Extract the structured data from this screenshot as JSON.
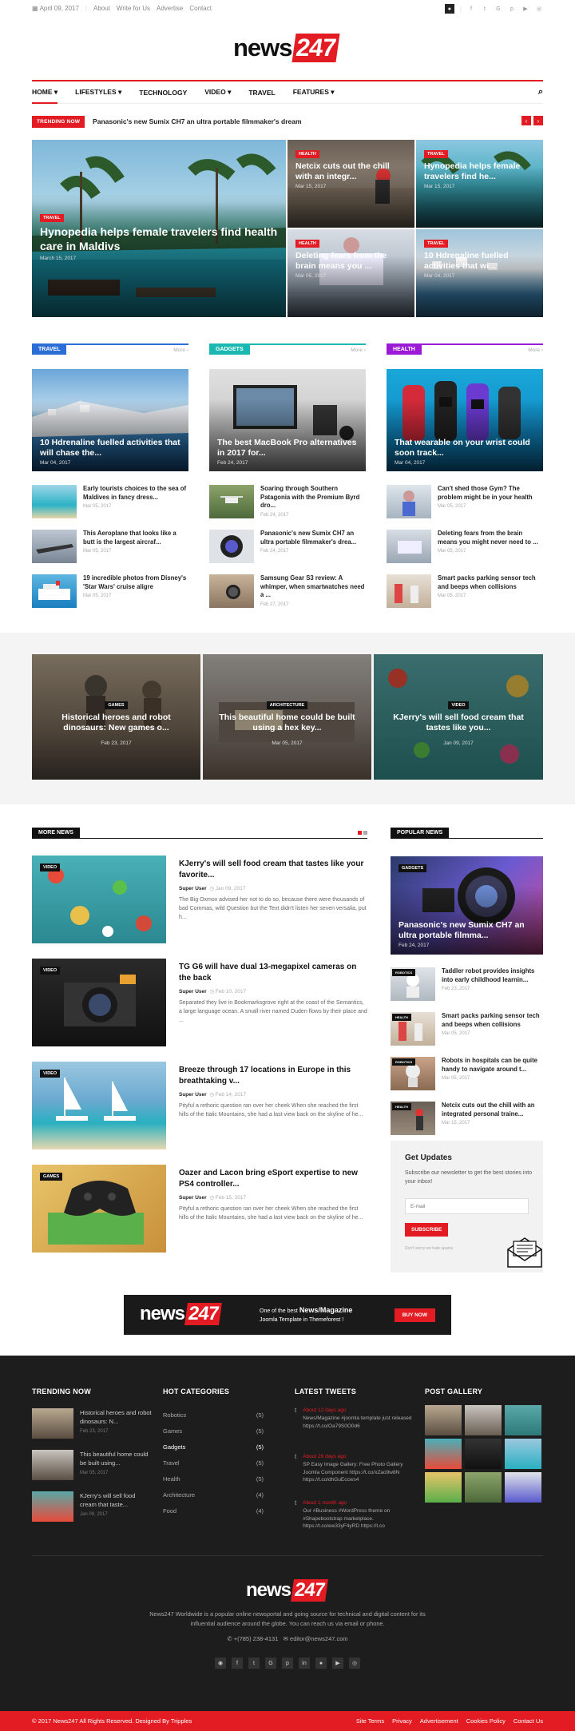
{
  "topbar": {
    "date": "April 09, 2017",
    "links": [
      "About",
      "Write for Us",
      "Advertise",
      "Contact"
    ]
  },
  "brand": {
    "name": "news",
    "number": "247",
    "accent": "#e31b23"
  },
  "nav": {
    "items": [
      "HOME",
      "LIFESTYLES",
      "TECHNOLOGY",
      "VIDEO",
      "TRAVEL",
      "FEATURES"
    ]
  },
  "trending": {
    "label": "TRENDING NOW",
    "text": "Panasonic's new Sumix CH7 an ultra portable filmmaker's dream"
  },
  "hero": {
    "main": {
      "tag": "TRAVEL",
      "title": "Hynopedia helps female travelers find health care in Maldivs",
      "date": "March 15, 2017"
    },
    "grid": [
      {
        "tag": "HEALTH",
        "title": "Netcix cuts out the chill with an integr...",
        "date": "Mar 15, 2017"
      },
      {
        "tag": "TRAVEL",
        "title": "Hynopedia helps female travelers find he...",
        "date": "Mar 15, 2017"
      },
      {
        "tag": "HEALTH",
        "title": "Deleting fears from the brain means you ...",
        "date": "Mar 05, 2017"
      },
      {
        "tag": "TRAVEL",
        "title": "10 Hdrenaline fuelled activities that wi...",
        "date": "Mar 04, 2017"
      }
    ]
  },
  "sections": [
    {
      "label": "TRAVEL",
      "more": "More",
      "color": "#2b6fd6",
      "lead": {
        "title": "10 Hdrenaline fuelled activities that will chase the...",
        "date": "Mar 04, 2017"
      },
      "items": [
        {
          "title": "Early tourists choices to the sea of Maldives in fancy dress...",
          "date": "Mar 05, 2017"
        },
        {
          "title": "This Aeroplane that looks like a butt is the largest aircraf...",
          "date": "Mar 05, 2017"
        },
        {
          "title": "19 incredible photos from Disney's 'Star Wars' cruise aligre",
          "date": "Mar 05, 2017"
        }
      ]
    },
    {
      "label": "GADGETS",
      "more": "More",
      "color": "#1ab8b0",
      "lead": {
        "title": "The best MacBook Pro alternatives in 2017 for...",
        "date": "Feb 24, 2017"
      },
      "items": [
        {
          "title": "Soaring through Southern Patagonia with the Premium Byrd dro...",
          "date": "Feb 24, 2017"
        },
        {
          "title": "Panasonic's new Sumix CH7 an ultra portable filmmaker's drea...",
          "date": "Feb 24, 2017"
        },
        {
          "title": "Samsung Gear S3 review: A whimper, when smartwatches need a ...",
          "date": "Feb 27, 2017"
        }
      ]
    },
    {
      "label": "HEALTH",
      "more": "More",
      "color": "#9b1ad6",
      "lead": {
        "title": "That wearable on your wrist could soon track...",
        "date": "Mar 04, 2017"
      },
      "items": [
        {
          "title": "Can't shed those Gym? The problem might be in your health",
          "date": "Mar 05, 2017"
        },
        {
          "title": "Deleting fears from the brain means you might never need to ...",
          "date": "Mar 05, 2017"
        },
        {
          "title": "Smart packs parking sensor tech and beeps when collisions",
          "date": "Mar 05, 2017"
        }
      ]
    }
  ],
  "featured": [
    {
      "tag": "GAMES",
      "title": "Historical heroes and robot dinosaurs: New games o...",
      "date": "Feb 23, 2017"
    },
    {
      "tag": "ARCHITECTURE",
      "title": "This beautiful home could be built using a hex key...",
      "date": "Mar 05, 2017"
    },
    {
      "tag": "VIDEO",
      "title": "KJerry's will sell food cream that tastes like you...",
      "date": "Jan 09, 2017"
    }
  ],
  "more_news": {
    "label": "MORE NEWS",
    "items": [
      {
        "tag": "VIDEO",
        "title": "KJerry's will sell food cream that tastes like your favorite...",
        "author": "Super User",
        "date": "Jan 09, 2017",
        "excerpt": "The Big Oxmox advised her not to do so, because there were thousands of bad Commas, wild Question but the Text didn't listen her seven versalia, put h..."
      },
      {
        "tag": "VIDEO",
        "title": "TG G6 will have dual 13-megapixel cameras on the back",
        "author": "Super User",
        "date": "Feb 10, 2017",
        "excerpt": "Separated they live in Bookmarksgrove right at the coast of the Semantics, a large language ocean. A small river named Duden flows by their place and ..."
      },
      {
        "tag": "VIDEO",
        "title": "Breeze through 17 locations in Europe in this breathtaking v...",
        "author": "Super User",
        "date": "Feb 14, 2017",
        "excerpt": "Pityful a rethoric question ran over her cheek When she reached the first hills of the Italic Mountains, she had a last view back on the skyline of he..."
      },
      {
        "tag": "GAMES",
        "title": "Oazer and Lacon bring eSport expertise to new PS4 controller...",
        "author": "Super User",
        "date": "Feb 15, 2017",
        "excerpt": "Pityful a rethoric question ran over her cheek When she reached the first hills of the Italic Mountains, she had a last view back on the skyline of he..."
      }
    ]
  },
  "popular": {
    "label": "POPULAR NEWS",
    "lead": {
      "tag": "GADGETS",
      "title": "Panasonic's new Sumix CH7 an ultra portable filmma...",
      "date": "Feb 24, 2017"
    },
    "items": [
      {
        "tag": "ROBOTICS",
        "title": "Taddler robot provides insights into early childhood learnin...",
        "date": "Feb 23, 2017"
      },
      {
        "tag": "HEALTH",
        "title": "Smart packs parking sensor tech and beeps when collisions",
        "date": "Mar 05, 2017"
      },
      {
        "tag": "ROBOTICS",
        "title": "Robots in hospitals can be quite handy to navigate around t...",
        "date": "Mar 05, 2017"
      },
      {
        "tag": "HEALTH",
        "title": "Netcix cuts out the chill with an integrated personal traine...",
        "date": "Mar 15, 2017"
      }
    ]
  },
  "newsletter": {
    "title": "Get Updates",
    "text": "Subscribe our newsletter to get the best stories into your inbox!",
    "placeholder": "E-mail",
    "button": "SUBSCRIBE",
    "note": "Don't worry we hate spams"
  },
  "ad": {
    "line1": "One of the best",
    "highlight": "News/Magazine",
    "line2": "Joomla Template in Themeforest !",
    "button": "BUY NOW"
  },
  "footer": {
    "trending": {
      "title": "TRENDING NOW",
      "items": [
        {
          "title": "Historical heroes and robot dinosaurs: N...",
          "date": "Feb 23, 2017"
        },
        {
          "title": "This beautiful home could be built using...",
          "date": "Mar 05, 2017"
        },
        {
          "title": "KJerry's will sell food cream that taste...",
          "date": "Jan 09, 2017"
        }
      ]
    },
    "categories": {
      "title": "HOT CATEGORIES",
      "items": [
        {
          "name": "Robotics",
          "count": "(5)"
        },
        {
          "name": "Games",
          "count": "(5)"
        },
        {
          "name": "Gadgets",
          "count": "(5)"
        },
        {
          "name": "Travel",
          "count": "(5)"
        },
        {
          "name": "Health",
          "count": "(5)"
        },
        {
          "name": "Architecture",
          "count": "(4)"
        },
        {
          "name": "Food",
          "count": "(4)"
        }
      ]
    },
    "tweets": {
      "title": "LATEST TWEETS",
      "items": [
        {
          "time": "About 12 days ago",
          "text": "News/Magazine #joomla template just released https://t.co/Oa79S0O0d6"
        },
        {
          "time": "About 29 days ago",
          "text": "SP Easy Image Gallery: Free Photo Gallery Joomla Component https://t.co/xZao9w8N https://t.co/dhGuEccws4"
        },
        {
          "time": "About 1 month ago",
          "text": "Our #Business #WordPress theme on #Shapebootstrap marketplace. https://t.co/ew33yF4yRD https://t.co"
        }
      ]
    },
    "gallery": {
      "title": "POST GALLERY"
    },
    "about": "News247 Worldwide is a popular online newsportal and going source for technical and digital content for its influential audience around the globe. You can reach us via email or phone.",
    "phone": "+(785) 238-4131",
    "email": "editor@news247.com",
    "copyright": "© 2017 News247 All Rights Reserved. Designed By Tripples",
    "links": [
      "Site Terms",
      "Privacy",
      "Advertisement",
      "Cookies Policy",
      "Contact Us"
    ]
  }
}
